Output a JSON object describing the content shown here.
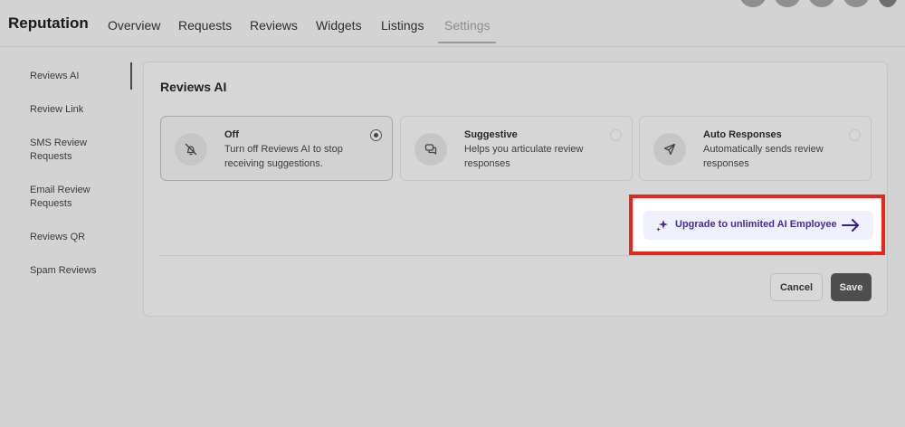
{
  "header": {
    "title": "Reputation",
    "tabs": [
      {
        "label": "Overview"
      },
      {
        "label": "Requests"
      },
      {
        "label": "Reviews"
      },
      {
        "label": "Widgets"
      },
      {
        "label": "Listings"
      },
      {
        "label": "Settings",
        "active": true
      }
    ]
  },
  "sidebar": {
    "items": [
      {
        "label": "Reviews AI",
        "active": true
      },
      {
        "label": "Review Link"
      },
      {
        "label": "SMS Review Requests"
      },
      {
        "label": "Email Review Requests"
      },
      {
        "label": "Reviews QR"
      },
      {
        "label": "Spam Reviews"
      }
    ]
  },
  "card": {
    "title": "Reviews AI",
    "options": [
      {
        "title": "Off",
        "description": "Turn off Reviews AI to stop receiving suggestions.",
        "icon": "bell-off-icon",
        "selected": true
      },
      {
        "title": "Suggestive",
        "description": "Helps you articulate review responses",
        "icon": "chat-bubbles-icon",
        "selected": false
      },
      {
        "title": "Auto Responses",
        "description": "Automatically sends review responses",
        "icon": "send-icon",
        "selected": false
      }
    ],
    "upgrade": {
      "label": "Upgrade to unlimited AI Employee",
      "icon": "sparkles-icon",
      "arrow_icon": "arrow-right-icon"
    },
    "cancel_label": "Cancel",
    "save_label": "Save"
  },
  "colors": {
    "highlight": "#e8261c",
    "upgrade_text": "#4b2aa6",
    "upgrade_bg": "#eef0fb",
    "save_bg": "#4e4e4e"
  }
}
